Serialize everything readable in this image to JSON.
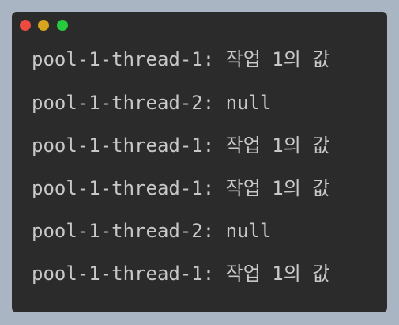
{
  "window": {
    "background": "#2b2b2b",
    "buttons": [
      {
        "name": "close",
        "color": "#ec4b3f"
      },
      {
        "name": "minimize",
        "color": "#d6a41f"
      },
      {
        "name": "zoom",
        "color": "#27c93f"
      }
    ]
  },
  "console": {
    "lines": [
      "pool-1-thread-1: 작업 1의 값",
      "pool-1-thread-2: null",
      "pool-1-thread-1: 작업 1의 값",
      "pool-1-thread-1: 작업 1의 값",
      "pool-1-thread-2: null",
      "pool-1-thread-1: 작업 1의 값"
    ]
  }
}
